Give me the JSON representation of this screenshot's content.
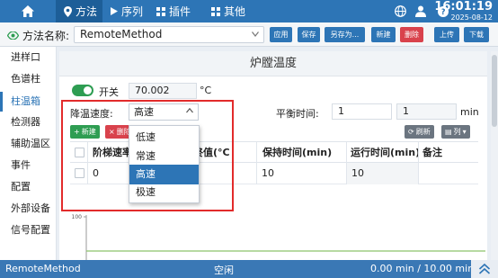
{
  "topbar": {
    "tabs": [
      {
        "label": "方法",
        "icon": "location-pin-icon"
      },
      {
        "label": "序列",
        "icon": "play-icon"
      },
      {
        "label": "插件",
        "icon": "grid-icon"
      },
      {
        "label": "其他",
        "icon": "grid-icon"
      }
    ],
    "time": "16:01:19",
    "date": "2025-08-12"
  },
  "methodbar": {
    "label": "方法名称:",
    "method_name": "RemoteMethod",
    "buttons": {
      "apply": "应用",
      "save": "保存",
      "save_as": "另存为...",
      "new": "新建",
      "delete": "删除",
      "upload": "上传",
      "download": "下载"
    }
  },
  "sidebar": {
    "items": [
      {
        "label": "进样口"
      },
      {
        "label": "色谱柱"
      },
      {
        "label": "柱温箱"
      },
      {
        "label": "检测器"
      },
      {
        "label": "辅助温区"
      },
      {
        "label": "事件"
      },
      {
        "label": "配置"
      },
      {
        "label": "外部设备"
      },
      {
        "label": "信号配置"
      }
    ]
  },
  "main": {
    "title": "炉膛温度",
    "switch_label": "开关",
    "temperature": "70.002",
    "temperature_unit": "°C",
    "cooling_speed_label": "降温速度:",
    "cooling_speed_value": "高速",
    "balance_time_label": "平衡时间:",
    "balance_time_value": "1",
    "balance_time_value2": "1",
    "balance_time_unit": "min",
    "new_button": "新建",
    "delete_button": "删除",
    "refresh_button": "刷新",
    "columns_button": "列"
  },
  "table": {
    "headers": [
      "阶梯速率",
      "终值(°C",
      "保持时间(min)",
      "运行时间(min)",
      "备注"
    ],
    "rows": [
      [
        "0",
        "",
        "10",
        "10",
        ""
      ]
    ]
  },
  "dropdown": {
    "options": [
      "低速",
      "常速",
      "高速",
      "极速"
    ],
    "selected_index": 2
  },
  "chart_data": {
    "type": "line",
    "ytick_labels": [
      "100"
    ]
  },
  "statusbar": {
    "method": "RemoteMethod",
    "state": "空闲",
    "progress": "0.00 min / 10.00 min"
  },
  "colors": {
    "accent": "#2d75b6",
    "danger": "#d9424c",
    "success": "#2e9d52",
    "highlight": "#e22b2b"
  }
}
